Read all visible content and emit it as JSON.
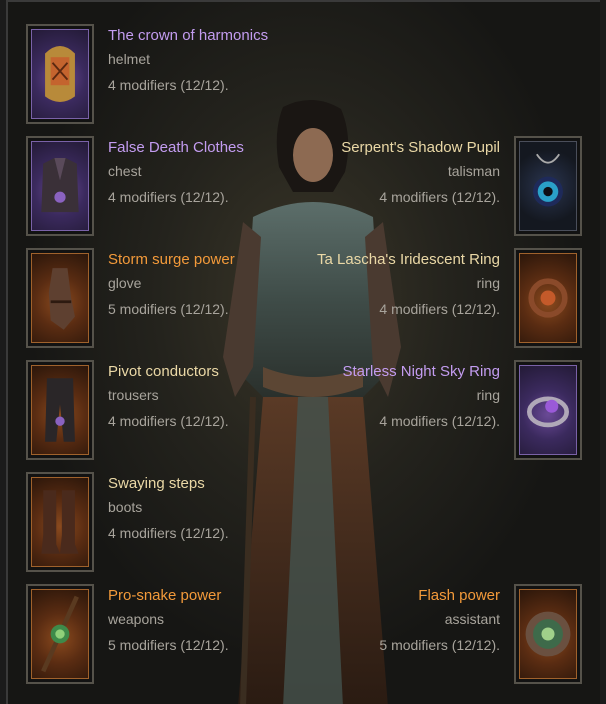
{
  "colors": {
    "legendary": "#f39a3a",
    "rare": "#c39cf0",
    "unique": "#ead8a6",
    "muted": "#a8a49c"
  },
  "left_slots": [
    {
      "name": "The crown of harmonics",
      "type": "helmet",
      "mods": "4 modifiers (12/12).",
      "rarity": "rare",
      "icon": "helmet-icon"
    },
    {
      "name": "False Death Clothes",
      "type": "chest",
      "mods": "4 modifiers (12/12).",
      "rarity": "rare",
      "icon": "chest-armor-icon"
    },
    {
      "name": "Storm surge power",
      "type": "glove",
      "mods": "5 modifiers (12/12).",
      "rarity": "legendary",
      "icon": "glove-icon"
    },
    {
      "name": "Pivot conductors",
      "type": "trousers",
      "mods": "4 modifiers (12/12).",
      "rarity": "unique",
      "icon": "trousers-icon"
    },
    {
      "name": "Swaying steps",
      "type": "boots",
      "mods": "4 modifiers (12/12).",
      "rarity": "unique",
      "icon": "boots-icon"
    },
    {
      "name": "Pro-snake power",
      "type": "weapons",
      "mods": "5 modifiers (12/12).",
      "rarity": "legendary",
      "icon": "staff-icon"
    }
  ],
  "right_slots": [
    {
      "name": "Serpent's Shadow Pupil",
      "type": "talisman",
      "mods": "4 modifiers (12/12).",
      "rarity": "unique",
      "icon": "amulet-icon"
    },
    {
      "name": "Ta Lascha's Iridescent Ring",
      "type": "ring",
      "mods": "4 modifiers (12/12).",
      "rarity": "unique",
      "icon": "ring-icon"
    },
    {
      "name": "Starless Night Sky Ring",
      "type": "ring",
      "mods": "4 modifiers (12/12).",
      "rarity": "rare",
      "icon": "ring-icon"
    },
    {
      "name": "Flash power",
      "type": "assistant",
      "mods": "5 modifiers (12/12).",
      "rarity": "legendary",
      "icon": "offhand-orb-icon"
    }
  ]
}
